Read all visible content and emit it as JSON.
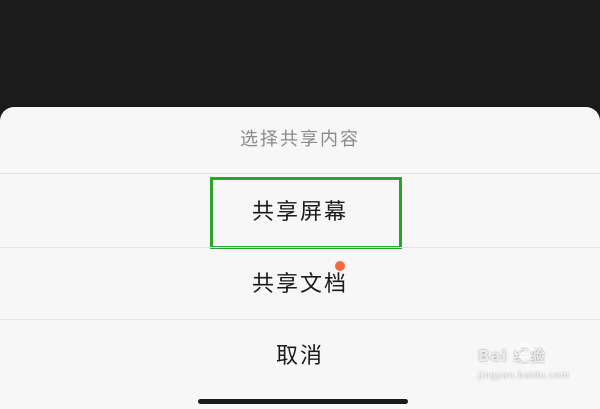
{
  "sheet": {
    "title": "选择共享内容",
    "options": [
      {
        "label": "共享屏幕",
        "highlighted": true
      },
      {
        "label": "共享文档",
        "has_badge": true
      },
      {
        "label": "取消"
      }
    ]
  },
  "watermark": {
    "text": "Bai 经验",
    "sub": "jingyan.baidu.com"
  },
  "colors": {
    "highlight_border": "#2aa42a",
    "badge": "#f26a3d",
    "sheet_background": "#f7f7f7",
    "backdrop": "#1b1b1b"
  }
}
